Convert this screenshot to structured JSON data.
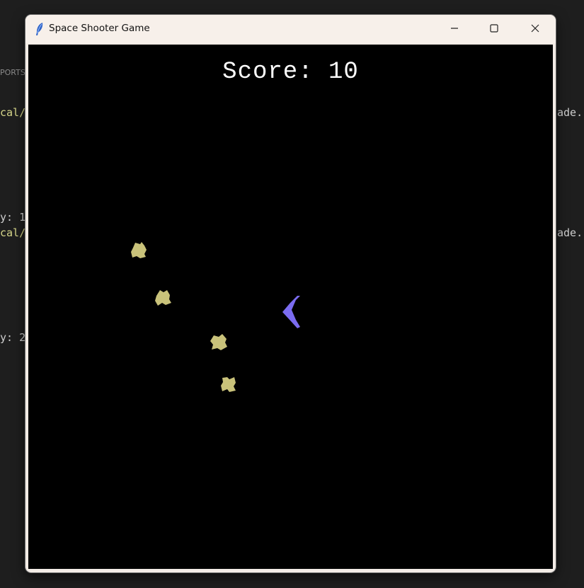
{
  "background": {
    "fragments": [
      {
        "text": "PORTS",
        "cls": "bg-dim"
      },
      {
        "text": "cal/",
        "cls": "bg-yellow"
      },
      {
        "text": "y: 1",
        "cls": "bg-white"
      },
      {
        "text": "cal/",
        "cls": "bg-yellow"
      },
      {
        "text": "y: 2",
        "cls": "bg-white"
      },
      {
        "text": "ade.",
        "cls": "bg-white"
      },
      {
        "text": "ade.",
        "cls": "bg-white"
      }
    ]
  },
  "window": {
    "title": "Space Shooter Game",
    "icon": "feather-icon",
    "controls": [
      "minimize-icon",
      "maximize-icon",
      "close-icon"
    ]
  },
  "game": {
    "score_text": "Score: 10",
    "score_value": 10,
    "background_color": "#000000",
    "player": {
      "color": "#7b6cf0",
      "icon": "spaceship-icon"
    },
    "asteroid_color": "#c9c27a",
    "asteroid_count": 4
  }
}
